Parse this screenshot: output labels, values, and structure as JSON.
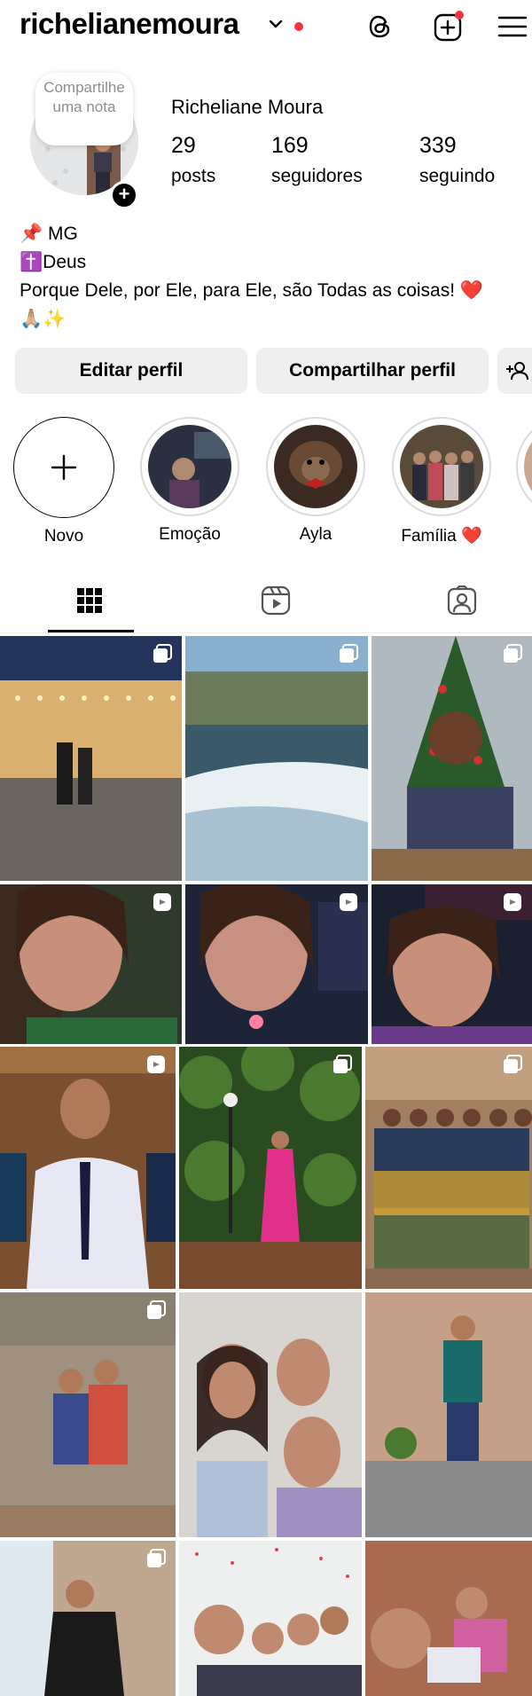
{
  "header": {
    "username": "richelianemoura",
    "icons": [
      "threads-icon",
      "create-post-icon",
      "menu-icon"
    ],
    "notification_color": "#ff3040"
  },
  "profile": {
    "note": "Compartilhe uma nota",
    "full_name": "Richeliane Moura",
    "stats": [
      {
        "value": "29",
        "label": "posts"
      },
      {
        "value": "169",
        "label": "seguidores"
      },
      {
        "value": "339",
        "label": "seguindo"
      }
    ],
    "bio": {
      "line1": "📌 MG",
      "line2": "✝️Deus",
      "line3": "Porque Dele, por Ele, para Ele, são Todas as coisas! ❤️",
      "line4": "🙏🏼✨"
    }
  },
  "actions": {
    "edit": "Editar perfil",
    "share": "Compartilhar perfil",
    "discover_icon": "add-person-icon"
  },
  "highlights": [
    {
      "label": "Novo"
    },
    {
      "label": "Emoção"
    },
    {
      "label": "Ayla"
    },
    {
      "label": "Família ❤️"
    }
  ],
  "tabs": [
    "grid-icon",
    "reels-icon",
    "tagged-icon"
  ],
  "grid_colors": {
    "row1": [
      "#3a4a6b",
      "#7a8f7a",
      "#c64a3a"
    ],
    "row2": [
      "#4a5a3a",
      "#2b2b3a",
      "#3a3a4a"
    ],
    "row3": [
      "#6a4a2a",
      "#3a5a2a",
      "#8a6a4a"
    ],
    "row4": [
      "#8a7060",
      "#c8c0b8",
      "#9a8a7a"
    ],
    "row5": [
      "#c8d0d8",
      "#e0e8e8",
      "#a06050"
    ]
  }
}
